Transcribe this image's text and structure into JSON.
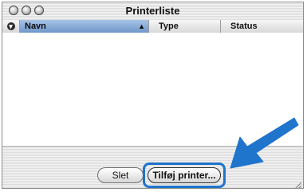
{
  "window": {
    "title": "Printerliste"
  },
  "columns": [
    {
      "label": "Navn",
      "sorted": true
    },
    {
      "label": "Type"
    },
    {
      "label": "Status"
    }
  ],
  "buttons": {
    "delete": "Slet",
    "add_printer": "Tilføj printer..."
  },
  "colors": {
    "highlight": "#1f74cc",
    "arrow": "#1f74cc"
  }
}
